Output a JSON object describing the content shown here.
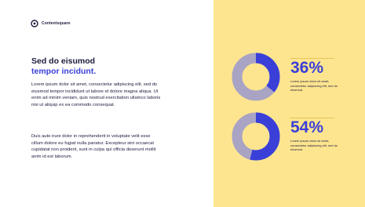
{
  "brand": {
    "name": "Contentsquare",
    "logo_icon": "contentsquare-logo-icon"
  },
  "headline": {
    "line1": "Sed do eisumod",
    "line2": "tempor incidunt."
  },
  "body": {
    "paragraph1": "Lorem ipsum dolor sit amet, consectetur adipiscing elit, sed do eiusmod tempor incididunt ut labore et dolore magna aliqua. Ut enim ad minim veniam, quis nostrud exercitation ullamco laboris nisi ut aliquip ex ea commodo consequat.",
    "paragraph2": "Duis aute irure dolor in reprehenderit in voluptate velit esse cillum dolore eu fugiat nulla pariatur. Excepteur sint occaecat cupidatat non proident, sunt in culpa qui officia deserunt mollit anim id est laborum."
  },
  "stats": [
    {
      "value": "36%",
      "fraction": 0.36,
      "caption": "Lorem ipsum dolor sit amet, consectetur adipiscing elit, sed do eiusmod."
    },
    {
      "value": "54%",
      "fraction": 0.54,
      "caption": "Lorem ipsum dolor sit amet, consectetur adipiscing elit, sed do eiusmod."
    }
  ],
  "colors": {
    "accent": "#3a3fd8",
    "ring_remainder": "#a9a4c4",
    "panel": "#fde58f",
    "text": "#1b1a3e"
  }
}
